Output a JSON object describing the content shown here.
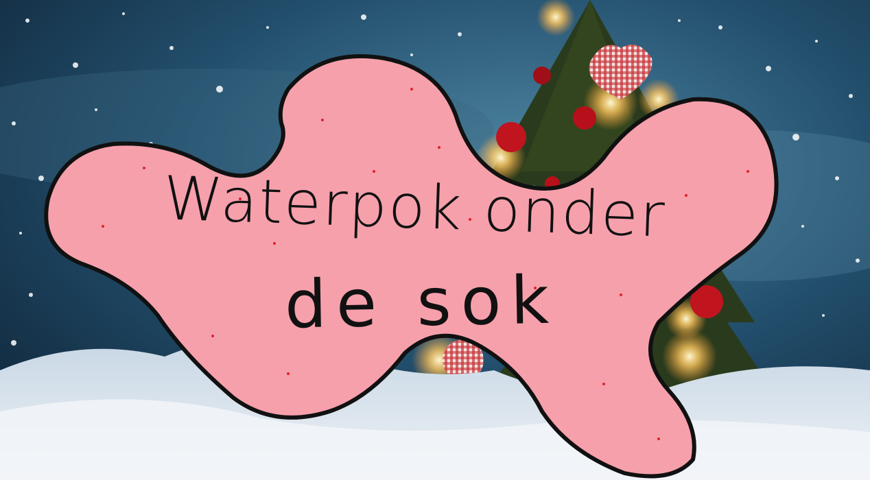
{
  "caption": {
    "line1": "Waterpok onder",
    "line2": "de sok"
  },
  "colors": {
    "sky_dark": "#0e2438",
    "sky_light": "#3f6f8c",
    "snow": "#dfe6ee",
    "blob_fill": "#f6a0ac",
    "blob_outline": "#111111",
    "ornament_red": "#c0141e",
    "light_glow": "#ffd27a",
    "tree_green": "#2c3a1c"
  }
}
